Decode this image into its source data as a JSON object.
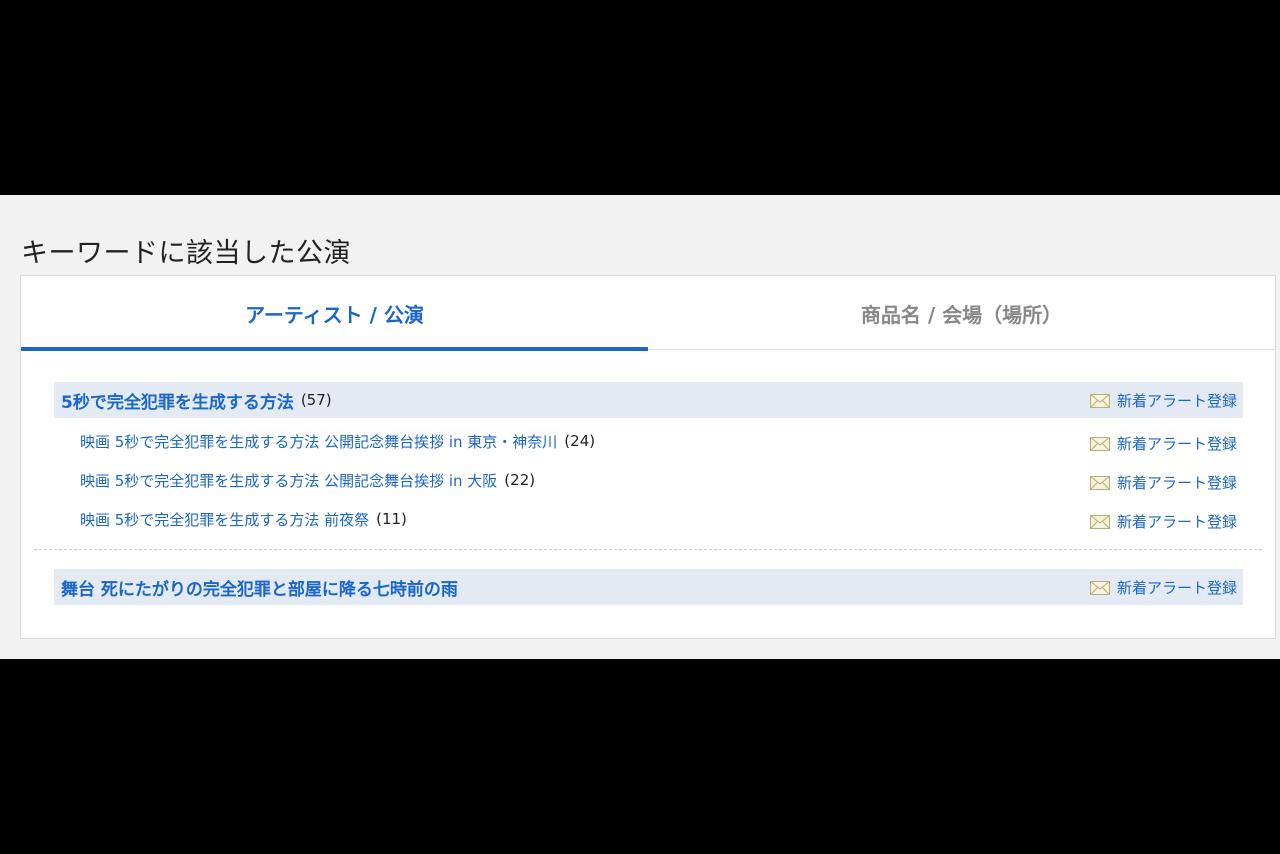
{
  "section_title": "キーワードに該当した公演",
  "tabs": [
    {
      "label": "アーティスト / 公演",
      "active": true
    },
    {
      "label": "商品名 / 会場（場所）",
      "active": false
    }
  ],
  "groups": [
    {
      "title": "5秒で完全犯罪を生成する方法",
      "count": "(57)",
      "alert_label": "新着アラート登録",
      "items": [
        {
          "title": "映画 5秒で完全犯罪を生成する方法 公開記念舞台挨拶 in 東京・神奈川",
          "count": "(24)",
          "alert_label": "新着アラート登録"
        },
        {
          "title": "映画 5秒で完全犯罪を生成する方法 公開記念舞台挨拶 in 大阪",
          "count": "(22)",
          "alert_label": "新着アラート登録"
        },
        {
          "title": "映画 5秒で完全犯罪を生成する方法 前夜祭",
          "count": "(11)",
          "alert_label": "新着アラート登録"
        }
      ]
    },
    {
      "title": "舞台 死にたがりの完全犯罪と部屋に降る七時前の雨",
      "count": "",
      "alert_label": "新着アラート登録",
      "items": []
    }
  ],
  "icons": {
    "alert": "mail-icon"
  },
  "colors": {
    "link": "#1a66c9",
    "header_bg": "#e3eaf3",
    "page_bg": "#f2f2f2"
  }
}
